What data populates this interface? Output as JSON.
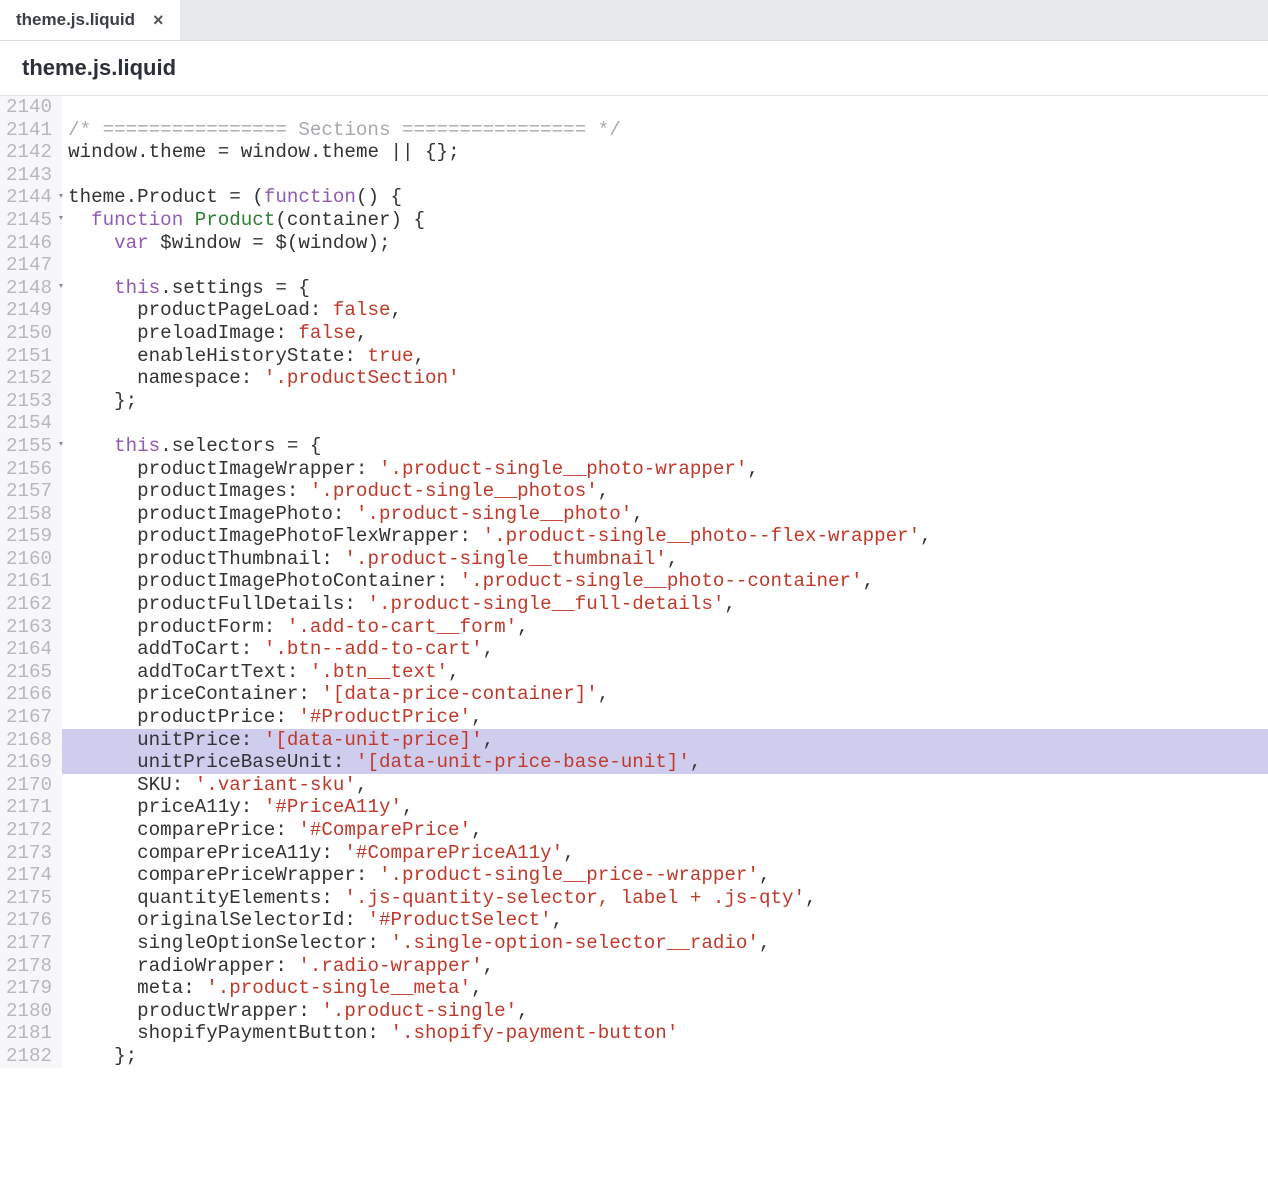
{
  "tab": {
    "label": "theme.js.liquid"
  },
  "file_header": "theme.js.liquid",
  "lines": [
    {
      "n": 2140,
      "fold": "",
      "hl": false,
      "tokens": []
    },
    {
      "n": 2141,
      "fold": "",
      "hl": false,
      "tokens": [
        {
          "t": "/* ================ Sections ================ */",
          "c": "c-comment"
        }
      ]
    },
    {
      "n": 2142,
      "fold": "",
      "hl": false,
      "tokens": [
        {
          "t": "window",
          "c": "c-plain"
        },
        {
          "t": ".",
          "c": "c-plain"
        },
        {
          "t": "theme",
          "c": "c-plain"
        },
        {
          "t": " = ",
          "c": "c-plain"
        },
        {
          "t": "window",
          "c": "c-plain"
        },
        {
          "t": ".",
          "c": "c-plain"
        },
        {
          "t": "theme",
          "c": "c-plain"
        },
        {
          "t": " || {};",
          "c": "c-plain"
        }
      ]
    },
    {
      "n": 2143,
      "fold": "",
      "hl": false,
      "tokens": []
    },
    {
      "n": 2144,
      "fold": "▾",
      "hl": false,
      "tokens": [
        {
          "t": "theme",
          "c": "c-plain"
        },
        {
          "t": ".",
          "c": "c-plain"
        },
        {
          "t": "Product",
          "c": "c-plain"
        },
        {
          "t": " = (",
          "c": "c-plain"
        },
        {
          "t": "function",
          "c": "c-kw"
        },
        {
          "t": "() {",
          "c": "c-plain"
        }
      ]
    },
    {
      "n": 2145,
      "fold": "▾",
      "hl": false,
      "tokens": [
        {
          "t": "  ",
          "c": "c-plain"
        },
        {
          "t": "function",
          "c": "c-kw"
        },
        {
          "t": " ",
          "c": "c-plain"
        },
        {
          "t": "Product",
          "c": "c-fn"
        },
        {
          "t": "(",
          "c": "c-plain"
        },
        {
          "t": "container",
          "c": "c-plain"
        },
        {
          "t": ") {",
          "c": "c-plain"
        }
      ]
    },
    {
      "n": 2146,
      "fold": "",
      "hl": false,
      "tokens": [
        {
          "t": "    ",
          "c": "c-plain"
        },
        {
          "t": "var",
          "c": "c-kw"
        },
        {
          "t": " $window = $(",
          "c": "c-plain"
        },
        {
          "t": "window",
          "c": "c-plain"
        },
        {
          "t": ");",
          "c": "c-plain"
        }
      ]
    },
    {
      "n": 2147,
      "fold": "",
      "hl": false,
      "tokens": []
    },
    {
      "n": 2148,
      "fold": "▾",
      "hl": false,
      "tokens": [
        {
          "t": "    ",
          "c": "c-plain"
        },
        {
          "t": "this",
          "c": "c-this"
        },
        {
          "t": ".settings = {",
          "c": "c-plain"
        }
      ]
    },
    {
      "n": 2149,
      "fold": "",
      "hl": false,
      "tokens": [
        {
          "t": "      productPageLoad: ",
          "c": "c-plain"
        },
        {
          "t": "false",
          "c": "c-bool"
        },
        {
          "t": ",",
          "c": "c-plain"
        }
      ]
    },
    {
      "n": 2150,
      "fold": "",
      "hl": false,
      "tokens": [
        {
          "t": "      preloadImage: ",
          "c": "c-plain"
        },
        {
          "t": "false",
          "c": "c-bool"
        },
        {
          "t": ",",
          "c": "c-plain"
        }
      ]
    },
    {
      "n": 2151,
      "fold": "",
      "hl": false,
      "tokens": [
        {
          "t": "      enableHistoryState: ",
          "c": "c-plain"
        },
        {
          "t": "true",
          "c": "c-bool"
        },
        {
          "t": ",",
          "c": "c-plain"
        }
      ]
    },
    {
      "n": 2152,
      "fold": "",
      "hl": false,
      "tokens": [
        {
          "t": "      namespace: ",
          "c": "c-plain"
        },
        {
          "t": "'.productSection'",
          "c": "c-str"
        }
      ]
    },
    {
      "n": 2153,
      "fold": "",
      "hl": false,
      "tokens": [
        {
          "t": "    };",
          "c": "c-plain"
        }
      ]
    },
    {
      "n": 2154,
      "fold": "",
      "hl": false,
      "tokens": []
    },
    {
      "n": 2155,
      "fold": "▾",
      "hl": false,
      "tokens": [
        {
          "t": "    ",
          "c": "c-plain"
        },
        {
          "t": "this",
          "c": "c-this"
        },
        {
          "t": ".selectors = {",
          "c": "c-plain"
        }
      ]
    },
    {
      "n": 2156,
      "fold": "",
      "hl": false,
      "tokens": [
        {
          "t": "      productImageWrapper: ",
          "c": "c-plain"
        },
        {
          "t": "'.product-single__photo-wrapper'",
          "c": "c-str"
        },
        {
          "t": ",",
          "c": "c-plain"
        }
      ]
    },
    {
      "n": 2157,
      "fold": "",
      "hl": false,
      "tokens": [
        {
          "t": "      productImages: ",
          "c": "c-plain"
        },
        {
          "t": "'.product-single__photos'",
          "c": "c-str"
        },
        {
          "t": ",",
          "c": "c-plain"
        }
      ]
    },
    {
      "n": 2158,
      "fold": "",
      "hl": false,
      "tokens": [
        {
          "t": "      productImagePhoto: ",
          "c": "c-plain"
        },
        {
          "t": "'.product-single__photo'",
          "c": "c-str"
        },
        {
          "t": ",",
          "c": "c-plain"
        }
      ]
    },
    {
      "n": 2159,
      "fold": "",
      "hl": false,
      "tokens": [
        {
          "t": "      productImagePhotoFlexWrapper: ",
          "c": "c-plain"
        },
        {
          "t": "'.product-single__photo--flex-wrapper'",
          "c": "c-str"
        },
        {
          "t": ",",
          "c": "c-plain"
        }
      ]
    },
    {
      "n": 2160,
      "fold": "",
      "hl": false,
      "tokens": [
        {
          "t": "      productThumbnail: ",
          "c": "c-plain"
        },
        {
          "t": "'.product-single__thumbnail'",
          "c": "c-str"
        },
        {
          "t": ",",
          "c": "c-plain"
        }
      ]
    },
    {
      "n": 2161,
      "fold": "",
      "hl": false,
      "tokens": [
        {
          "t": "      productImagePhotoContainer: ",
          "c": "c-plain"
        },
        {
          "t": "'.product-single__photo--container'",
          "c": "c-str"
        },
        {
          "t": ",",
          "c": "c-plain"
        }
      ]
    },
    {
      "n": 2162,
      "fold": "",
      "hl": false,
      "tokens": [
        {
          "t": "      productFullDetails: ",
          "c": "c-plain"
        },
        {
          "t": "'.product-single__full-details'",
          "c": "c-str"
        },
        {
          "t": ",",
          "c": "c-plain"
        }
      ]
    },
    {
      "n": 2163,
      "fold": "",
      "hl": false,
      "tokens": [
        {
          "t": "      productForm: ",
          "c": "c-plain"
        },
        {
          "t": "'.add-to-cart__form'",
          "c": "c-str"
        },
        {
          "t": ",",
          "c": "c-plain"
        }
      ]
    },
    {
      "n": 2164,
      "fold": "",
      "hl": false,
      "tokens": [
        {
          "t": "      addToCart: ",
          "c": "c-plain"
        },
        {
          "t": "'.btn--add-to-cart'",
          "c": "c-str"
        },
        {
          "t": ",",
          "c": "c-plain"
        }
      ]
    },
    {
      "n": 2165,
      "fold": "",
      "hl": false,
      "tokens": [
        {
          "t": "      addToCartText: ",
          "c": "c-plain"
        },
        {
          "t": "'.btn__text'",
          "c": "c-str"
        },
        {
          "t": ",",
          "c": "c-plain"
        }
      ]
    },
    {
      "n": 2166,
      "fold": "",
      "hl": false,
      "tokens": [
        {
          "t": "      priceContainer: ",
          "c": "c-plain"
        },
        {
          "t": "'[data-price-container]'",
          "c": "c-str"
        },
        {
          "t": ",",
          "c": "c-plain"
        }
      ]
    },
    {
      "n": 2167,
      "fold": "",
      "hl": false,
      "tokens": [
        {
          "t": "      productPrice: ",
          "c": "c-plain"
        },
        {
          "t": "'#ProductPrice'",
          "c": "c-str"
        },
        {
          "t": ",",
          "c": "c-plain"
        }
      ]
    },
    {
      "n": 2168,
      "fold": "",
      "hl": true,
      "tokens": [
        {
          "t": "      unitPrice: ",
          "c": "c-plain"
        },
        {
          "t": "'[data-unit-price]'",
          "c": "c-str"
        },
        {
          "t": ",",
          "c": "c-plain"
        }
      ]
    },
    {
      "n": 2169,
      "fold": "",
      "hl": true,
      "tokens": [
        {
          "t": "      unitPriceBaseUnit: ",
          "c": "c-plain"
        },
        {
          "t": "'[data-unit-price-base-unit]'",
          "c": "c-str"
        },
        {
          "t": ",",
          "c": "c-plain"
        }
      ]
    },
    {
      "n": 2170,
      "fold": "",
      "hl": false,
      "tokens": [
        {
          "t": "      SKU: ",
          "c": "c-plain"
        },
        {
          "t": "'.variant-sku'",
          "c": "c-str"
        },
        {
          "t": ",",
          "c": "c-plain"
        }
      ]
    },
    {
      "n": 2171,
      "fold": "",
      "hl": false,
      "tokens": [
        {
          "t": "      priceA11y: ",
          "c": "c-plain"
        },
        {
          "t": "'#PriceA11y'",
          "c": "c-str"
        },
        {
          "t": ",",
          "c": "c-plain"
        }
      ]
    },
    {
      "n": 2172,
      "fold": "",
      "hl": false,
      "tokens": [
        {
          "t": "      comparePrice: ",
          "c": "c-plain"
        },
        {
          "t": "'#ComparePrice'",
          "c": "c-str"
        },
        {
          "t": ",",
          "c": "c-plain"
        }
      ]
    },
    {
      "n": 2173,
      "fold": "",
      "hl": false,
      "tokens": [
        {
          "t": "      comparePriceA11y: ",
          "c": "c-plain"
        },
        {
          "t": "'#ComparePriceA11y'",
          "c": "c-str"
        },
        {
          "t": ",",
          "c": "c-plain"
        }
      ]
    },
    {
      "n": 2174,
      "fold": "",
      "hl": false,
      "tokens": [
        {
          "t": "      comparePriceWrapper: ",
          "c": "c-plain"
        },
        {
          "t": "'.product-single__price--wrapper'",
          "c": "c-str"
        },
        {
          "t": ",",
          "c": "c-plain"
        }
      ]
    },
    {
      "n": 2175,
      "fold": "",
      "hl": false,
      "tokens": [
        {
          "t": "      quantityElements: ",
          "c": "c-plain"
        },
        {
          "t": "'.js-quantity-selector, label + .js-qty'",
          "c": "c-str"
        },
        {
          "t": ",",
          "c": "c-plain"
        }
      ]
    },
    {
      "n": 2176,
      "fold": "",
      "hl": false,
      "tokens": [
        {
          "t": "      originalSelectorId: ",
          "c": "c-plain"
        },
        {
          "t": "'#ProductSelect'",
          "c": "c-str"
        },
        {
          "t": ",",
          "c": "c-plain"
        }
      ]
    },
    {
      "n": 2177,
      "fold": "",
      "hl": false,
      "tokens": [
        {
          "t": "      singleOptionSelector: ",
          "c": "c-plain"
        },
        {
          "t": "'.single-option-selector__radio'",
          "c": "c-str"
        },
        {
          "t": ",",
          "c": "c-plain"
        }
      ]
    },
    {
      "n": 2178,
      "fold": "",
      "hl": false,
      "tokens": [
        {
          "t": "      radioWrapper: ",
          "c": "c-plain"
        },
        {
          "t": "'.radio-wrapper'",
          "c": "c-str"
        },
        {
          "t": ",",
          "c": "c-plain"
        }
      ]
    },
    {
      "n": 2179,
      "fold": "",
      "hl": false,
      "tokens": [
        {
          "t": "      meta: ",
          "c": "c-plain"
        },
        {
          "t": "'.product-single__meta'",
          "c": "c-str"
        },
        {
          "t": ",",
          "c": "c-plain"
        }
      ]
    },
    {
      "n": 2180,
      "fold": "",
      "hl": false,
      "tokens": [
        {
          "t": "      productWrapper: ",
          "c": "c-plain"
        },
        {
          "t": "'.product-single'",
          "c": "c-str"
        },
        {
          "t": ",",
          "c": "c-plain"
        }
      ]
    },
    {
      "n": 2181,
      "fold": "",
      "hl": false,
      "tokens": [
        {
          "t": "      shopifyPaymentButton: ",
          "c": "c-plain"
        },
        {
          "t": "'.shopify-payment-button'",
          "c": "c-str"
        }
      ]
    },
    {
      "n": 2182,
      "fold": "",
      "hl": false,
      "tokens": [
        {
          "t": "    };",
          "c": "c-plain"
        }
      ]
    }
  ]
}
